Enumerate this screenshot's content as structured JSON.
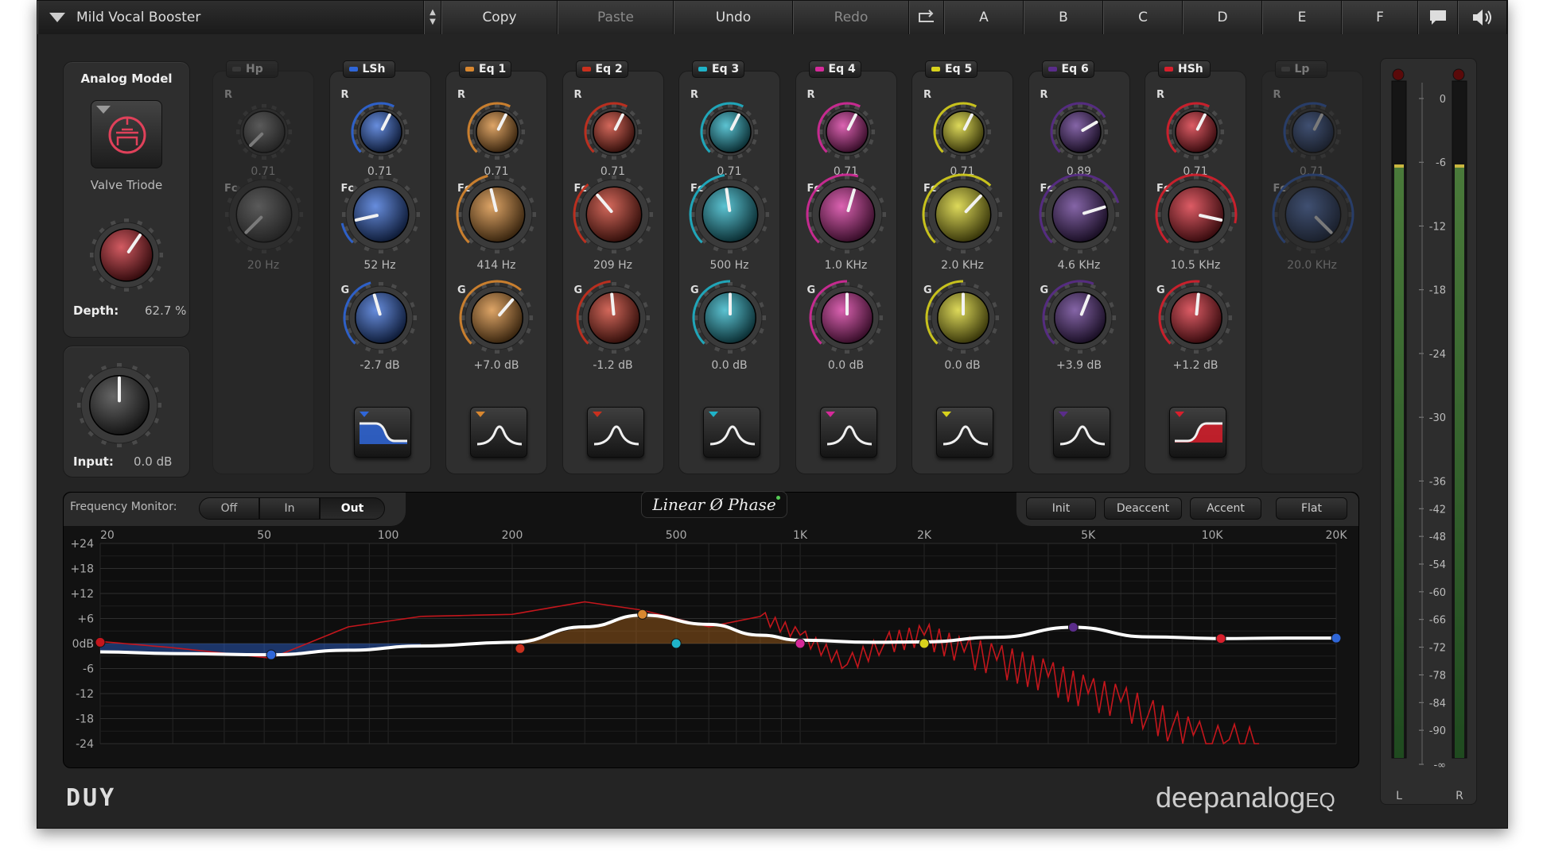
{
  "topbar": {
    "preset_name": "Mild Vocal Booster",
    "copy": "Copy",
    "paste": "Paste",
    "undo": "Undo",
    "redo": "Redo",
    "slots": [
      "A",
      "B",
      "C",
      "D",
      "E",
      "F"
    ]
  },
  "analog_model": {
    "title": "Analog Model",
    "model_name": "Valve Triode",
    "depth_label": "Depth:",
    "depth_value": "62.7 %",
    "depth_fraction": 0.627
  },
  "input": {
    "label": "Input:",
    "value": "0.0 dB"
  },
  "band_param_labels": {
    "r": "R",
    "fc": "Fc",
    "g": "G"
  },
  "bands": [
    {
      "name": "Hp",
      "enabled": false,
      "color": "#888888",
      "r": "0.71",
      "fc": "20 Hz",
      "g": null,
      "r_pos": 0.0,
      "fc_pos": 0.0,
      "g_pos": null,
      "shape": null
    },
    {
      "name": "LSh",
      "enabled": true,
      "color": "#2f66d8",
      "r": "0.71",
      "fc": "52 Hz",
      "g": "-2.7 dB",
      "r_pos": 0.6,
      "fc_pos": 0.12,
      "g_pos": 0.44,
      "shape": "low-shelf"
    },
    {
      "name": "Eq 1",
      "enabled": true,
      "color": "#d9872f",
      "r": "0.71",
      "fc": "414 Hz",
      "g": "+7.0 dB",
      "r_pos": 0.6,
      "fc_pos": 0.45,
      "g_pos": 0.65,
      "shape": "bell"
    },
    {
      "name": "Eq 2",
      "enabled": true,
      "color": "#c9301e",
      "r": "0.71",
      "fc": "209 Hz",
      "g": "-1.2 dB",
      "r_pos": 0.6,
      "fc_pos": 0.35,
      "g_pos": 0.48,
      "shape": "bell"
    },
    {
      "name": "Eq 3",
      "enabled": true,
      "color": "#1fb3c8",
      "r": "0.71",
      "fc": "500 Hz",
      "g": "0.0 dB",
      "r_pos": 0.6,
      "fc_pos": 0.47,
      "g_pos": 0.5,
      "shape": "bell"
    },
    {
      "name": "Eq 4",
      "enabled": true,
      "color": "#d62a9a",
      "r": "0.71",
      "fc": "1.0 KHz",
      "g": "0.0 dB",
      "r_pos": 0.6,
      "fc_pos": 0.56,
      "g_pos": 0.5,
      "shape": "bell"
    },
    {
      "name": "Eq 5",
      "enabled": true,
      "color": "#d8d21c",
      "r": "0.71",
      "fc": "2.0 KHz",
      "g": "0.0 dB",
      "r_pos": 0.6,
      "fc_pos": 0.66,
      "g_pos": 0.5,
      "shape": "bell"
    },
    {
      "name": "Eq 6",
      "enabled": true,
      "color": "#5a2c8a",
      "r": "0.89",
      "fc": "4.6 KHz",
      "g": "+3.9 dB",
      "r_pos": 0.72,
      "fc_pos": 0.77,
      "g_pos": 0.58,
      "shape": "bell"
    },
    {
      "name": "HSh",
      "enabled": true,
      "color": "#d81f2c",
      "r": "0.71",
      "fc": "10.5 KHz",
      "g": "+1.2 dB",
      "r_pos": 0.6,
      "fc_pos": 0.88,
      "g_pos": 0.52,
      "shape": "high-shelf"
    },
    {
      "name": "Lp",
      "enabled": false,
      "color": "#2f66d8",
      "r": "0.71",
      "fc": "20.0 KHz",
      "g": null,
      "r_pos": 0.6,
      "fc_pos": 1.0,
      "g_pos": null,
      "shape": null
    }
  ],
  "monitor": {
    "label": "Frequency Monitor:",
    "options": [
      "Off",
      "In",
      "Out"
    ],
    "selected": "Out"
  },
  "phase_badge": "Linear Ø Phase",
  "preset_buttons": [
    "Init",
    "Deaccent",
    "Accent",
    "Flat"
  ],
  "graph": {
    "freq_labels": [
      "20",
      "50",
      "100",
      "200",
      "500",
      "1K",
      "2K",
      "5K",
      "10K",
      "20K"
    ],
    "gain_labels": [
      "+24",
      "+18",
      "+12",
      "+6",
      "0dB",
      "-6",
      "-12",
      "-18",
      "-24"
    ]
  },
  "chart_data": {
    "type": "line",
    "title": "",
    "xlabel": "",
    "ylabel": "",
    "x_scale": "log",
    "xlim": [
      20,
      20000
    ],
    "ylim": [
      -24,
      24
    ],
    "grid": true,
    "series": [
      {
        "color": "#ffffff",
        "x": [
          20,
          30,
          52,
          80,
          120,
          200,
          300,
          414,
          600,
          800,
          1000,
          1500,
          2000,
          3000,
          4600,
          7000,
          10500,
          15000,
          20000
        ],
        "y": [
          -2.0,
          -2.4,
          -2.7,
          -1.6,
          -0.6,
          0.3,
          4.0,
          6.8,
          4.6,
          2.0,
          0.8,
          0.3,
          0.4,
          1.5,
          3.9,
          1.6,
          1.2,
          1.3,
          1.3
        ]
      },
      {
        "color": "#c4161c",
        "x": [
          20,
          30,
          52,
          80,
          120,
          200,
          300,
          414,
          600,
          800,
          1000,
          1300,
          1600,
          2000,
          2500,
          3000,
          4000,
          5000,
          6000,
          7000,
          8000,
          9000,
          10000,
          11000,
          12000,
          13000
        ],
        "y": [
          0.5,
          -1.0,
          -3.5,
          4.0,
          6.5,
          7.0,
          10.0,
          8.0,
          4.0,
          6.5,
          2.0,
          -5.0,
          0.0,
          2.0,
          -2.0,
          -4.0,
          -8.0,
          -12.0,
          -14.0,
          -17.0,
          -20.0,
          -22.0,
          -24.0,
          -23.0,
          -24.0,
          -24.0
        ]
      }
    ],
    "markers": [
      {
        "x": 20,
        "y": 0.3,
        "color": "#c4161c"
      },
      {
        "x": 52,
        "y": -2.7,
        "color": "#2f66d8"
      },
      {
        "x": 209,
        "y": -1.2,
        "color": "#c9301e"
      },
      {
        "x": 414,
        "y": 7.0,
        "color": "#d9872f"
      },
      {
        "x": 500,
        "y": 0.0,
        "color": "#1fb3c8"
      },
      {
        "x": 1000,
        "y": 0.0,
        "color": "#d62a9a"
      },
      {
        "x": 2000,
        "y": 0.0,
        "color": "#d8d21c"
      },
      {
        "x": 4600,
        "y": 3.9,
        "color": "#5a2c8a"
      },
      {
        "x": 10500,
        "y": 1.2,
        "color": "#d81f2c"
      },
      {
        "x": 20000,
        "y": 1.3,
        "color": "#2f66d8"
      }
    ]
  },
  "meter": {
    "scale": [
      "0",
      "-6",
      "-12",
      "-18",
      "-24",
      "-30",
      "-36",
      "-42",
      "-48",
      "-54",
      "-60",
      "-66",
      "-72",
      "-78",
      "-84",
      "-90",
      "-∞"
    ],
    "left_label": "L",
    "right_label": "R",
    "left_level": 0.9,
    "right_level": 0.9
  },
  "branding": {
    "logo": "DUY",
    "product_main": "deepanalog",
    "product_eq": "EQ"
  }
}
